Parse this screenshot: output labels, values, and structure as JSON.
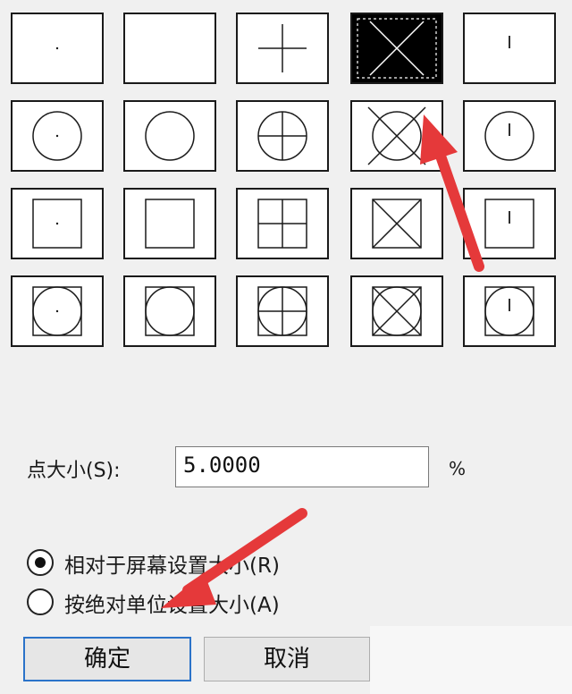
{
  "point_styles": [
    {
      "id": "dot",
      "selected": false
    },
    {
      "id": "none",
      "selected": false
    },
    {
      "id": "plus",
      "selected": false
    },
    {
      "id": "cross",
      "selected": true
    },
    {
      "id": "tick",
      "selected": false
    },
    {
      "id": "circle-dot",
      "selected": false
    },
    {
      "id": "circle",
      "selected": false
    },
    {
      "id": "circle-plus",
      "selected": false
    },
    {
      "id": "circle-cross",
      "selected": false
    },
    {
      "id": "circle-tick",
      "selected": false
    },
    {
      "id": "square-dot",
      "selected": false
    },
    {
      "id": "square",
      "selected": false
    },
    {
      "id": "square-plus",
      "selected": false
    },
    {
      "id": "square-cross",
      "selected": false
    },
    {
      "id": "square-tick",
      "selected": false
    },
    {
      "id": "square-circle-dot",
      "selected": false
    },
    {
      "id": "square-circle",
      "selected": false
    },
    {
      "id": "square-circle-plus",
      "selected": false
    },
    {
      "id": "square-circle-cross",
      "selected": false
    },
    {
      "id": "square-circle-tick",
      "selected": false
    }
  ],
  "point_size": {
    "label": "点大小(S):",
    "value": "5.0000",
    "unit": "%"
  },
  "size_mode": {
    "relative_label": "相对于屏幕设置大小(R)",
    "absolute_label": "按绝对单位设置大小(A)",
    "selected": "relative"
  },
  "buttons": {
    "ok": "确定",
    "cancel": "取消"
  },
  "colors": {
    "accent": "#2b73c9",
    "annotation_arrow": "#e5393a"
  }
}
